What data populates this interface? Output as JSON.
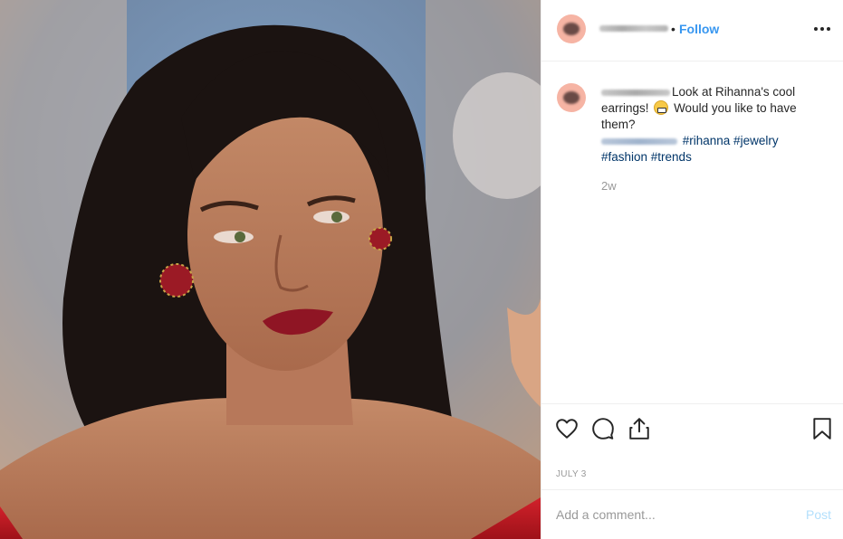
{
  "post": {
    "follow_label": "Follow",
    "separator": "•",
    "caption": {
      "text_part1": "Look at Rihanna's cool earrings!",
      "text_part2": "Would you like to have them?",
      "hashtags_line1": "#rihanna #jewelry",
      "hashtags_line2": "#fashion #trends"
    },
    "timestamp": "2w",
    "date": "JULY 3"
  },
  "comment_box": {
    "placeholder": "Add a comment...",
    "post_label": "Post"
  },
  "icons": {
    "more": "more-options-icon",
    "like": "heart-icon",
    "comment": "comment-bubble-icon",
    "share": "share-icon",
    "save": "bookmark-icon"
  },
  "colors": {
    "follow": "#3897f0",
    "hashtag": "#003569",
    "post_disabled": "#b2dffc",
    "avatar": "#f6b4a4"
  }
}
